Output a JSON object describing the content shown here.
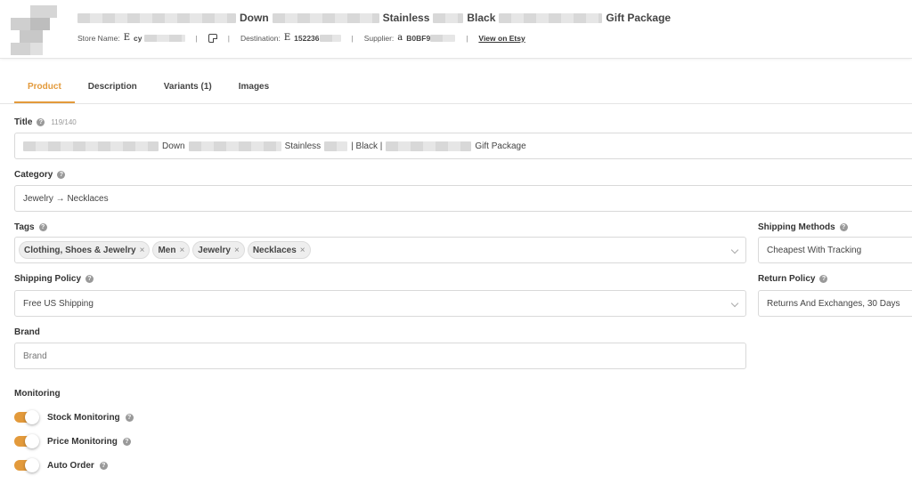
{
  "product": {
    "title_parts": [
      "Down",
      "Stainless",
      "Black",
      "Gift Package"
    ],
    "store_label": "Store Name:",
    "store_value": "cy",
    "destination_label": "Destination:",
    "destination_value": "152236",
    "supplier_label": "Supplier:",
    "supplier_value": "B0BF9",
    "view_link": "View on Etsy",
    "etsy_glyph": "E",
    "amazon_glyph": "a",
    "separator": "|"
  },
  "tabs": [
    {
      "label": "Product",
      "active": true
    },
    {
      "label": "Description",
      "active": false
    },
    {
      "label": "Variants (1)",
      "active": false
    },
    {
      "label": "Images",
      "active": false
    }
  ],
  "form": {
    "title_label": "Title",
    "title_counter": "119/140",
    "title_parts": [
      "Down",
      "Stainless",
      "| Black |",
      "Gift Package"
    ],
    "category_label": "Category",
    "category_value": "Jewelry → Necklaces",
    "tags_label": "Tags",
    "tags": [
      "Clothing, Shoes & Jewelry",
      "Men",
      "Jewelry",
      "Necklaces"
    ],
    "tag_remove": "×",
    "shipping_methods_label": "Shipping Methods",
    "shipping_methods_value": "Cheapest With Tracking",
    "shipping_policy_label": "Shipping Policy",
    "shipping_policy_value": "Free US Shipping",
    "return_policy_label": "Return Policy",
    "return_policy_value": "Returns And Exchanges, 30 Days",
    "brand_label": "Brand",
    "brand_placeholder": "Brand",
    "help_glyph": "?"
  },
  "monitoring": {
    "title": "Monitoring",
    "items": [
      {
        "label": "Stock Monitoring",
        "on": true
      },
      {
        "label": "Price Monitoring",
        "on": true
      },
      {
        "label": "Auto Order",
        "on": true
      }
    ]
  },
  "colors": {
    "accent": "#e39a3b",
    "border": "#d9d9d9",
    "text": "#333333"
  }
}
